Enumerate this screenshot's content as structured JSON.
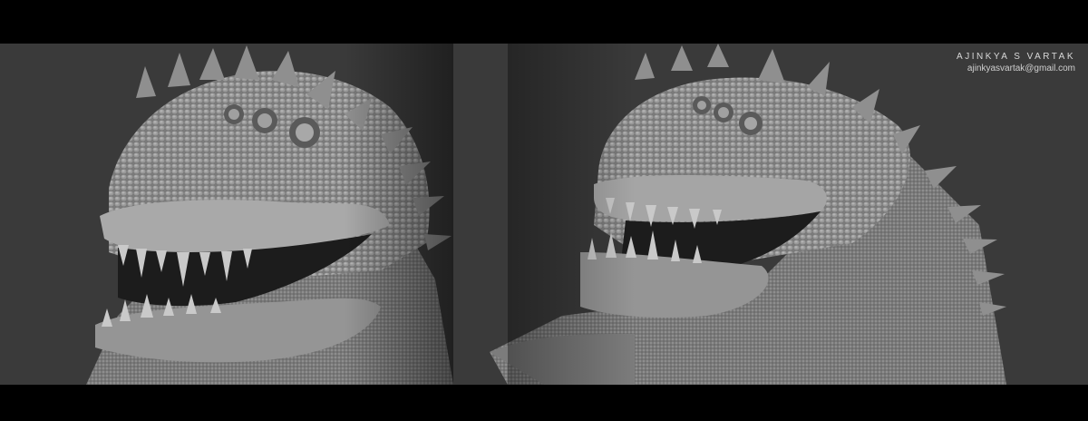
{
  "credit": {
    "name": "AJINKYA S VARTAK",
    "email": "ajinkyasvartak@gmail.com"
  },
  "colors": {
    "letterbox": "#000000",
    "background": "#3a3a3a",
    "sculpt_light": "#bdbdbd",
    "sculpt_mid": "#8a8a8a",
    "sculpt_dark": "#1e1e1e"
  }
}
